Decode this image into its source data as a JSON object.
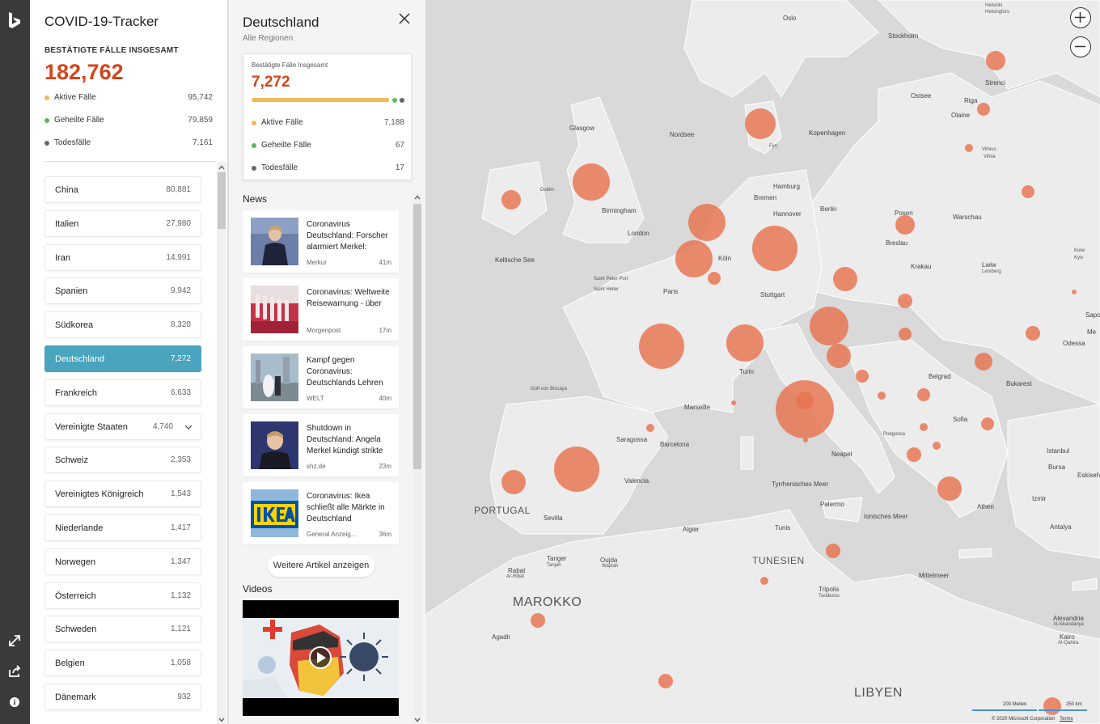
{
  "rail": {
    "icons": [
      "bing-logo-icon",
      "expand-icon",
      "share-icon",
      "info-icon"
    ]
  },
  "tracker": {
    "title": "COVID-19-Tracker",
    "total_label": "BESTÄTIGTE FÄLLE INSGESAMT",
    "total_value": "182,762",
    "stats": [
      {
        "label": "Aktive Fälle",
        "value": "95,742",
        "color": "#f0b95c"
      },
      {
        "label": "Geheilte Fälle",
        "value": "79,859",
        "color": "#5cb85c"
      },
      {
        "label": "Todesfälle",
        "value": "7,161",
        "color": "#666666"
      }
    ],
    "countries": [
      {
        "name": "China",
        "value": "80,881"
      },
      {
        "name": "Italien",
        "value": "27,980"
      },
      {
        "name": "Iran",
        "value": "14,991"
      },
      {
        "name": "Spanien",
        "value": "9,942"
      },
      {
        "name": "Südkorea",
        "value": "8,320"
      },
      {
        "name": "Deutschland",
        "value": "7,272",
        "active": true
      },
      {
        "name": "Frankreich",
        "value": "6,633"
      },
      {
        "name": "Vereinigte Staaten",
        "value": "4,740",
        "expandable": true
      },
      {
        "name": "Schweiz",
        "value": "2,353"
      },
      {
        "name": "Vereinigtes Königreich",
        "value": "1,543"
      },
      {
        "name": "Niederlande",
        "value": "1,417"
      },
      {
        "name": "Norwegen",
        "value": "1,347"
      },
      {
        "name": "Österreich",
        "value": "1,132"
      },
      {
        "name": "Schweden",
        "value": "1,121"
      },
      {
        "name": "Belgien",
        "value": "1,058"
      },
      {
        "name": "Dänemark",
        "value": "932"
      }
    ]
  },
  "detail": {
    "title": "Deutschland",
    "subtitle": "Alle Regionen",
    "card": {
      "label": "Bestätigte Fälle Insgesamt",
      "value": "7,272",
      "stats": [
        {
          "label": "Aktive Fälle",
          "value": "7,188",
          "color": "#f0b95c"
        },
        {
          "label": "Geheilte Fälle",
          "value": "67",
          "color": "#5cb85c"
        },
        {
          "label": "Todesfälle",
          "value": "17",
          "color": "#666666"
        }
      ]
    },
    "news_heading": "News",
    "news": [
      {
        "title": "Coronavirus Deutschland: Forscher alarmiert Merkel:",
        "source": "Merkur",
        "time": "41m",
        "thumb": "merkel-portrait"
      },
      {
        "title": "Coronavirus: Weltweite Reisewarnung - über",
        "source": "Morgenpost",
        "time": "17m",
        "thumb": "test-tubes"
      },
      {
        "title": "Kampf gegen Coronavirus: Deutschlands Lehren",
        "source": "WELT",
        "time": "40m",
        "thumb": "city-couple"
      },
      {
        "title": "Shutdown in Deutschland: Angela Merkel kündigt strikte",
        "source": "shz.de",
        "time": "23m",
        "thumb": "merkel-speech"
      },
      {
        "title": "Coronavirus: Ikea schließt alle Märkte in Deutschland",
        "source": "General Anzeig...",
        "time": "36m",
        "thumb": "ikea-sign"
      }
    ],
    "more_label": "Weitere Artikel anzeigen",
    "videos_heading": "Videos"
  },
  "map": {
    "labels": [
      {
        "text": "Helsinki",
        "cls": "small"
      },
      {
        "text": "Helsingfors",
        "cls": "small"
      },
      {
        "text": "Oslo",
        "cls": ""
      },
      {
        "text": "Stockholm",
        "cls": ""
      },
      {
        "text": "Riga",
        "cls": ""
      },
      {
        "text": "Strenci",
        "cls": ""
      },
      {
        "text": "Ostsee",
        "cls": ""
      },
      {
        "text": "Olaine",
        "cls": ""
      },
      {
        "text": "Glasgow",
        "cls": ""
      },
      {
        "text": "Nordsee",
        "cls": ""
      },
      {
        "text": "Kopenhagen",
        "cls": ""
      },
      {
        "text": "Fyn",
        "cls": "small"
      },
      {
        "text": "Vilnius",
        "cls": "small"
      },
      {
        "text": "Vilnia",
        "cls": "small"
      },
      {
        "text": "Dublin",
        "cls": "small"
      },
      {
        "text": "Hamburg",
        "cls": ""
      },
      {
        "text": "Bremen",
        "cls": ""
      },
      {
        "text": "Birmingham",
        "cls": ""
      },
      {
        "text": "Berlin",
        "cls": ""
      },
      {
        "text": "Hannover",
        "cls": ""
      },
      {
        "text": "Posen",
        "cls": ""
      },
      {
        "text": "Warschau",
        "cls": ""
      },
      {
        "text": "London",
        "cls": ""
      },
      {
        "text": "Breslau",
        "cls": ""
      },
      {
        "text": "Keltische See",
        "cls": ""
      },
      {
        "text": "Köln",
        "cls": ""
      },
      {
        "text": "Krakau",
        "cls": ""
      },
      {
        "text": "Lwiw",
        "cls": ""
      },
      {
        "text": "Lemberg",
        "cls": "small"
      },
      {
        "text": "Saint Peter Port",
        "cls": "small"
      },
      {
        "text": "Saint Helier",
        "cls": "small"
      },
      {
        "text": "Paris",
        "cls": ""
      },
      {
        "text": "Stuttgart",
        "cls": ""
      },
      {
        "text": "Odessa",
        "cls": ""
      },
      {
        "text": "Turin",
        "cls": ""
      },
      {
        "text": "Belgrad",
        "cls": ""
      },
      {
        "text": "Bukarest",
        "cls": ""
      },
      {
        "text": "Golf von Biscaya",
        "cls": "small"
      },
      {
        "text": "Marseille",
        "cls": ""
      },
      {
        "text": "Saragossa",
        "cls": ""
      },
      {
        "text": "Barcelona",
        "cls": ""
      },
      {
        "text": "Podgorica",
        "cls": "small"
      },
      {
        "text": "Sofia",
        "cls": ""
      },
      {
        "text": "Neapel",
        "cls": ""
      },
      {
        "text": "Istanbul",
        "cls": ""
      },
      {
        "text": "Valencia",
        "cls": ""
      },
      {
        "text": "Bursa",
        "cls": ""
      },
      {
        "text": "Eskisehir",
        "cls": ""
      },
      {
        "text": "PORTUGAL",
        "cls": "big"
      },
      {
        "text": "Tyrrhenisches Meer",
        "cls": ""
      },
      {
        "text": "Izmir",
        "cls": ""
      },
      {
        "text": "Sevilla",
        "cls": ""
      },
      {
        "text": "Palermo",
        "cls": ""
      },
      {
        "text": "Ionisches Meer",
        "cls": ""
      },
      {
        "text": "Athen",
        "cls": ""
      },
      {
        "text": "Algier",
        "cls": ""
      },
      {
        "text": "Tunis",
        "cls": ""
      },
      {
        "text": "Antalya",
        "cls": ""
      },
      {
        "text": "Tanger",
        "cls": ""
      },
      {
        "text": "Tanjah",
        "cls": "small"
      },
      {
        "text": "Oujda",
        "cls": ""
      },
      {
        "text": "Wajdah",
        "cls": "small"
      },
      {
        "text": "TUNESIEN",
        "cls": "big"
      },
      {
        "text": "Rabat",
        "cls": ""
      },
      {
        "text": "Ar-Ribāt",
        "cls": "small"
      },
      {
        "text": "Mittelmeer",
        "cls": ""
      },
      {
        "text": "Tripolis",
        "cls": ""
      },
      {
        "text": "Tarābulus",
        "cls": "small"
      },
      {
        "text": "MAROKKO",
        "cls": "xl"
      },
      {
        "text": "Alexandria",
        "cls": ""
      },
      {
        "text": "Al-Iskandariya",
        "cls": "small"
      },
      {
        "text": "Kairo",
        "cls": ""
      },
      {
        "text": "Al-Qahira",
        "cls": "small"
      },
      {
        "text": "Agadir",
        "cls": ""
      },
      {
        "text": "LIBYEN",
        "cls": "xl"
      },
      {
        "text": "Kiew",
        "cls": "small"
      },
      {
        "text": "Kyiv",
        "cls": "small"
      },
      {
        "text": "Sapo",
        "cls": ""
      },
      {
        "text": "Me",
        "cls": ""
      }
    ],
    "scale_miles": "200 Meilen",
    "scale_km": "250 km",
    "copyright": "© 2020 Microsoft Corporation",
    "terms": "Terms",
    "bubble_color": "#e8734f"
  }
}
